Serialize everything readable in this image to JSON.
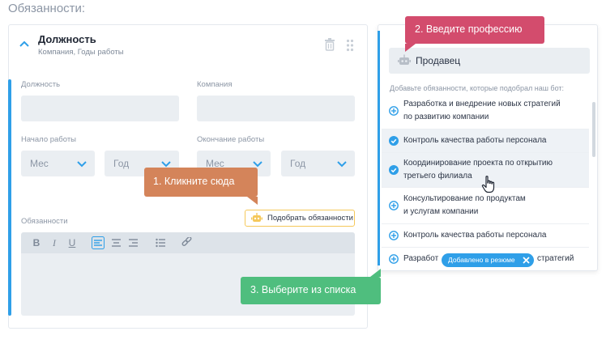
{
  "section_title": "Обязанности:",
  "card": {
    "title": "Должность",
    "subtitle": "Компания, Годы работы",
    "position_label": "Должность",
    "company_label": "Компания",
    "start_label": "Начало работы",
    "end_label": "Окончание работы",
    "month_placeholder": "Мес",
    "year_placeholder": "Год",
    "duties_label": "Обязанности",
    "pick_duties_button": "Подобрать обязанности",
    "toolbar": {
      "bold": "B",
      "italic": "I",
      "underline": "U"
    }
  },
  "tooltips": {
    "step1": "1. Кликните сюда",
    "step2": "2. Введите профессию",
    "step3": "3. Выберите из списка"
  },
  "panel": {
    "profession_value": "Продавец",
    "hint": "Добавьте обязанности, которые подобрал наш бот:",
    "items": [
      {
        "line1": "Разработка и внедрение новых стратегий",
        "line2": "по развитию компании",
        "state": "add"
      },
      {
        "line1": "Контроль качества работы персонала",
        "line2": "",
        "state": "selected"
      },
      {
        "line1": "Координирование проекта по открытию",
        "line2": "третьего филиала",
        "state": "selected"
      },
      {
        "line1": "Консультирование по продуктам",
        "line2": "и услугам компании",
        "state": "add"
      },
      {
        "line1": "Контроль качества работы персонала",
        "line2": "",
        "state": "add"
      },
      {
        "line1": "Разработ",
        "line2": "",
        "tail": "стратегий",
        "state": "add"
      }
    ],
    "added_badge": "Добавлено в резюме"
  },
  "colors": {
    "accent": "#2f9fe8",
    "step1": "#d4845a",
    "step2": "#d34c6d",
    "step3": "#4fbe7e",
    "field_bg": "#eaeef2",
    "pick_border": "#f5c85a"
  }
}
